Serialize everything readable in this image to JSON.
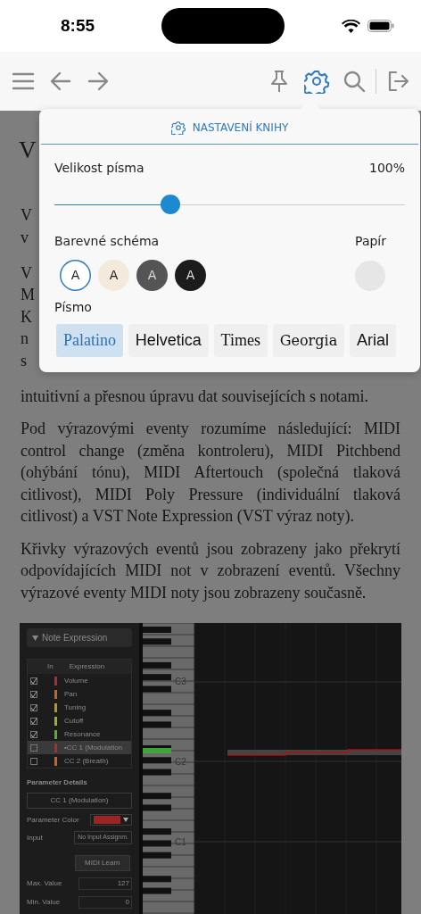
{
  "status_bar": {
    "time": "8:55"
  },
  "toolbar": {
    "items": [
      {
        "kind": "menu",
        "selected": false
      },
      {
        "kind": "back",
        "selected": false
      },
      {
        "kind": "forward",
        "selected": false
      },
      {
        "kind": "pin",
        "selected": false
      },
      {
        "kind": "settings",
        "selected": true
      },
      {
        "kind": "search",
        "selected": false
      },
      {
        "kind": "exit",
        "selected": false
      }
    ]
  },
  "article": {
    "title": "V",
    "covered_lines": [
      [
        "V",
        "v"
      ],
      [
        "V",
        "M",
        "K",
        "n",
        "s"
      ]
    ],
    "paragraphs": [
      "intuitivní a přesnou úpravu dat souvisejících s notami.",
      "Pod výrazovými eventy rozumíme následující: MIDI control change (změna kontroleru), MIDI Pitchbend (ohýbání tónu), MIDI Aftertouch (společná tlaková citlivost), MIDI Poly Pressure (individuální tlaková citlivost) a VST Note Expression (VST výraz noty).",
      "Křivky výrazových eventů jsou zobrazeny jako překrytí odpovídajících MIDI not v zobrazení eventů. Všechny výrazové eventy MIDI noty jsou zobrazeny současně."
    ],
    "figure": {
      "panel_title": "Note Expression",
      "columns": [
        "In",
        "Expression"
      ],
      "rows": [
        {
          "label": "Volume",
          "checked": true,
          "color": "#b42a2a",
          "selected": false
        },
        {
          "label": "Pan",
          "checked": true,
          "color": "#c8641e",
          "selected": false
        },
        {
          "label": "Tuning",
          "checked": true,
          "color": "#b8961e",
          "selected": false
        },
        {
          "label": "Cutoff",
          "checked": true,
          "color": "#98b41e",
          "selected": false
        },
        {
          "label": "Resonance",
          "checked": true,
          "color": "#50b428",
          "selected": false
        },
        {
          "label": "•CC 1  (Modulation",
          "checked": false,
          "color": "#b42a2a",
          "selected": true
        },
        {
          "label": "CC 2  (Breath)",
          "checked": false,
          "color": "#c8641e",
          "selected": false
        }
      ],
      "section_title": "Parameter Details",
      "parameter_name": "CC 1  (Modulation)",
      "color_label": "Parameter Color",
      "input_label": "Input",
      "input_value": "No Input Assignm.",
      "learn_button": "MIDI Learn",
      "value_fields": [
        {
          "label": "Max. Value",
          "value": "127"
        },
        {
          "label": "Min. Value",
          "value": "0"
        }
      ],
      "octave_labels": [
        "C3",
        "C2",
        "C1"
      ]
    }
  },
  "settings_popover": {
    "title": "NASTAVENÍ KNIHY",
    "font_size": {
      "label": "Velikost písma",
      "reading": "100%",
      "level": 0.33
    },
    "color_scheme": {
      "label": "Barevné schéma",
      "options": [
        {
          "label": "A",
          "color": "#ffffff",
          "selected": true
        },
        {
          "label": "A",
          "color": "#f3eadb",
          "selected": false
        },
        {
          "label": "A",
          "color": "#555555",
          "selected": false
        },
        {
          "label": "A",
          "color": "#1c1c1c",
          "selected": false
        }
      ]
    },
    "paper": {
      "label": "Papír"
    },
    "font": {
      "label": "Písmo",
      "options": [
        {
          "label": "Palatino",
          "kind": "serif",
          "selected": true
        },
        {
          "label": "Helvetica",
          "kind": "sans",
          "selected": false
        },
        {
          "label": "Times",
          "kind": "serif",
          "selected": false
        },
        {
          "label": "Georgia",
          "kind": "wideserif",
          "selected": false
        },
        {
          "label": "Arial",
          "kind": "sans",
          "selected": false
        }
      ]
    }
  }
}
